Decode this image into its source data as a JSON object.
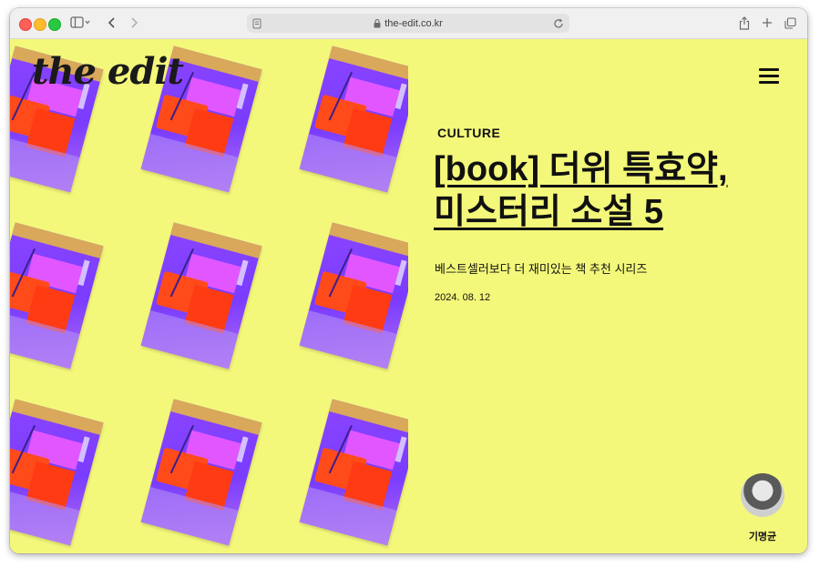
{
  "browser": {
    "url": "the-edit.co.kr"
  },
  "site": {
    "logo": "the edit"
  },
  "article": {
    "category": "CULTURE",
    "title_line1": "[book] 더위 특효약,",
    "title_line2": "미스터리 소설 5",
    "subtitle": "베스트셀러보다 더 재미있는 책 추천 시리즈",
    "date": "2024. 08. 12"
  },
  "author": {
    "name": "기명균"
  },
  "icons": {
    "sidebar": "sidebar-toggle-icon",
    "back": "chevron-left-icon",
    "forward": "chevron-right-icon",
    "lock": "lock-icon",
    "reload": "reload-icon",
    "share": "share-icon",
    "new_tab": "plus-icon",
    "tabs": "tab-overview-icon",
    "menu": "hamburger-menu-icon"
  },
  "colors": {
    "page_background": "#f4f87a",
    "text": "#111111",
    "cover_purple": "#8a45ff",
    "cover_orange": "#ff4a1a"
  }
}
